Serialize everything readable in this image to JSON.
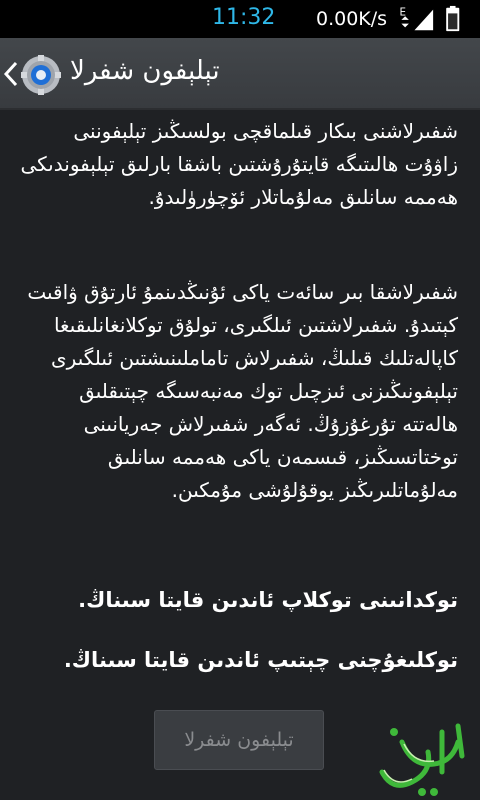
{
  "status_bar": {
    "time": "11:32",
    "network_speed": "0.00K/s",
    "network_type": "E",
    "icons": [
      "data-transfer-icon",
      "signal-icon",
      "battery-icon"
    ]
  },
  "action_bar": {
    "title": "تېلېفون شفرلا",
    "icons": [
      "back-chevron-icon",
      "settings-gear-icon"
    ]
  },
  "content": {
    "paragraph_1": "شفىرلاشنى بىكار قىلماقچى بولسىڭىز تېلېفوننى زاۋۇت ھالىتىگە قايتۇرۇشتىن باشقا بارلىق تېلېفوندىكى ھەممە سانلىق مەلۇماتلار ئۆچۈرۈلىدۇ.",
    "paragraph_2": "شفىرلاشقا بىر سائەت ياكى ئۇنىڭدىنمۇ ئارتۇق ۋاقىت كېتىدۇ. شفىرلاشتىن ئىلگىرى، تولۇق توكلانغانلىقىغا كاپالەتلىك قىلىڭ، شفىرلاش تاماملىنىشتىن ئىلگىرى تېلېفونىڭىزنى ئىزچىل توك مەنبەسىگە چېتىقلىق ھالەتتە تۇرغۇزۇڭ. ئەگەر شفىرلاش جەريانىنى توختاتسىڭىز، قىسمەن ياكى ھەممە سانلىق مەلۇماتلىرىڭىز يوقۇلۇشى مۇمكىن.",
    "warning_1": "توكدانىنى توكلاپ ئاندىن قايتا سىناڭ.",
    "warning_2": "توكلىغۇچنى چېتىپ ئاندىن قايتا سىناڭ."
  },
  "reset_button": {
    "label": "تېلېفون شفرلا",
    "enabled": false
  },
  "watermark": {
    "text": "ئەلتۇي",
    "icon": "watermark-logo"
  },
  "colors": {
    "status_time": "#2fb8e8",
    "background": "#1f2124",
    "action_bar": "#3d4044",
    "disabled_text": "#8a8c8f",
    "watermark_green": "#3fb83a"
  }
}
